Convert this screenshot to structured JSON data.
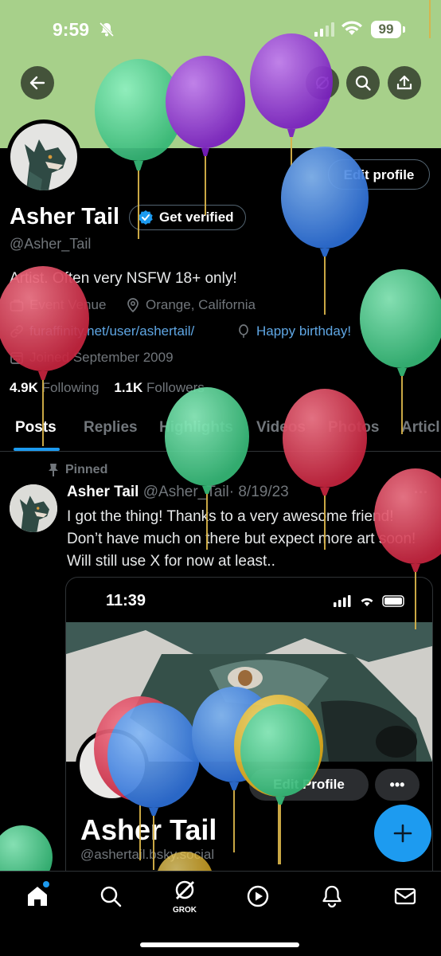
{
  "status_bar": {
    "time": "9:59",
    "battery": "99"
  },
  "profile": {
    "name": "Asher Tail",
    "handle": "@Asher_Tail",
    "edit_label": "Edit profile",
    "verify_label": "Get verified",
    "bio": "Artist. Often very NSFW 18+ only!",
    "category": "Event Venue",
    "location": "Orange, California",
    "website": "furaffinity.net/user/ashertail/",
    "birthday": "Happy birthday!",
    "joined": "Joined September 2009",
    "following_count": "4.9K",
    "following_label": "Following",
    "followers_count": "1.1K",
    "followers_label": "Followers"
  },
  "tabs": [
    "Posts",
    "Replies",
    "Highlights",
    "Videos",
    "Photos",
    "Articl"
  ],
  "post": {
    "pinned_label": "Pinned",
    "author": "Asher Tail",
    "handle": "@Asher_Tail",
    "date": "· 8/19/23",
    "text": "I got the thing! Thanks to a very awesome friend! Don’t have much on there but expect more art soon! Will still use X for now at least..",
    "media": {
      "time": "11:39",
      "edit_label": "Edit Profile",
      "more_label": "•••",
      "name": "Asher Tail",
      "handle": "@ashertail.bsky.social"
    }
  },
  "nav": {
    "grok_label": "GROK"
  },
  "colors": {
    "banner": "#a7d08a",
    "accent": "#1d9bf0",
    "balloon_green": "#5fd39a",
    "balloon_purple": "#9b3fd6",
    "balloon_blue": "#4a8ee8",
    "balloon_red": "#e0475f",
    "balloon_yellow": "#f0c43b"
  }
}
